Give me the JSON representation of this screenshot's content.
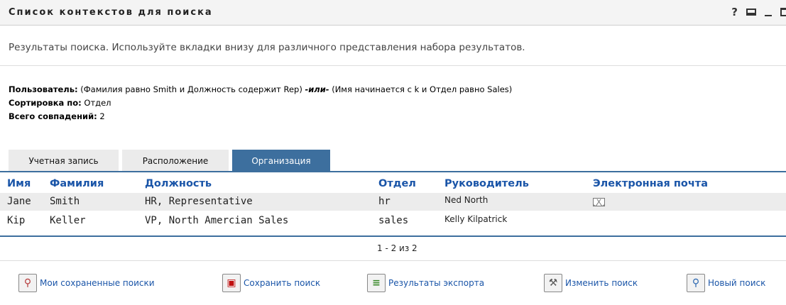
{
  "panel": {
    "title": "Список контекстов для поиска",
    "icons": [
      "help-icon",
      "print-icon",
      "minimize-icon",
      "maximize-icon"
    ],
    "help_glyph": "?"
  },
  "description": "Результаты поиска. Используйте вкладки внизу для различного представления набора результатов.",
  "criteria": {
    "user_label": "Пользователь:",
    "user_part1": "(Фамилия равно Smith и Должность содержит Rep)",
    "user_or": "-или-",
    "user_part2": "(Имя начинается с k и Отдел равно Sales)",
    "sort_label": "Сортировка по:",
    "sort_value": "Отдел",
    "total_label": "Всего совпадений:",
    "total_value": "2"
  },
  "tabs": [
    {
      "label": "Учетная запись",
      "active": false
    },
    {
      "label": "Расположение",
      "active": false
    },
    {
      "label": "Организация",
      "active": true
    }
  ],
  "table": {
    "headers": [
      "Имя",
      "Фамилия",
      "Должность",
      "Отдел",
      "Руководитель",
      "Электронная почта"
    ],
    "rows": [
      {
        "first": "Jane",
        "last": "Smith",
        "title": "HR, Representative",
        "dept": "hr",
        "manager": "Ned North",
        "email_icon": "mail-icon"
      },
      {
        "first": "Kip",
        "last": "Keller",
        "title": "VP, North Amercian Sales",
        "dept": "sales",
        "manager": "Kelly Kilpatrick",
        "email_icon": ""
      }
    ],
    "pager": "1 - 2 из 2"
  },
  "actions": [
    {
      "label": "Мои сохраненные поиски",
      "icon": "saved-searches-icon"
    },
    {
      "label": "Сохранить поиск",
      "icon": "save-icon"
    },
    {
      "label": "Результаты экспорта",
      "icon": "export-icon"
    },
    {
      "label": "Изменить поиск",
      "icon": "edit-search-icon"
    },
    {
      "label": "Новый поиск",
      "icon": "new-search-icon"
    }
  ],
  "colors": {
    "accent": "#3d6f9e",
    "link": "#1a55a8",
    "row_alt": "#ececec"
  }
}
